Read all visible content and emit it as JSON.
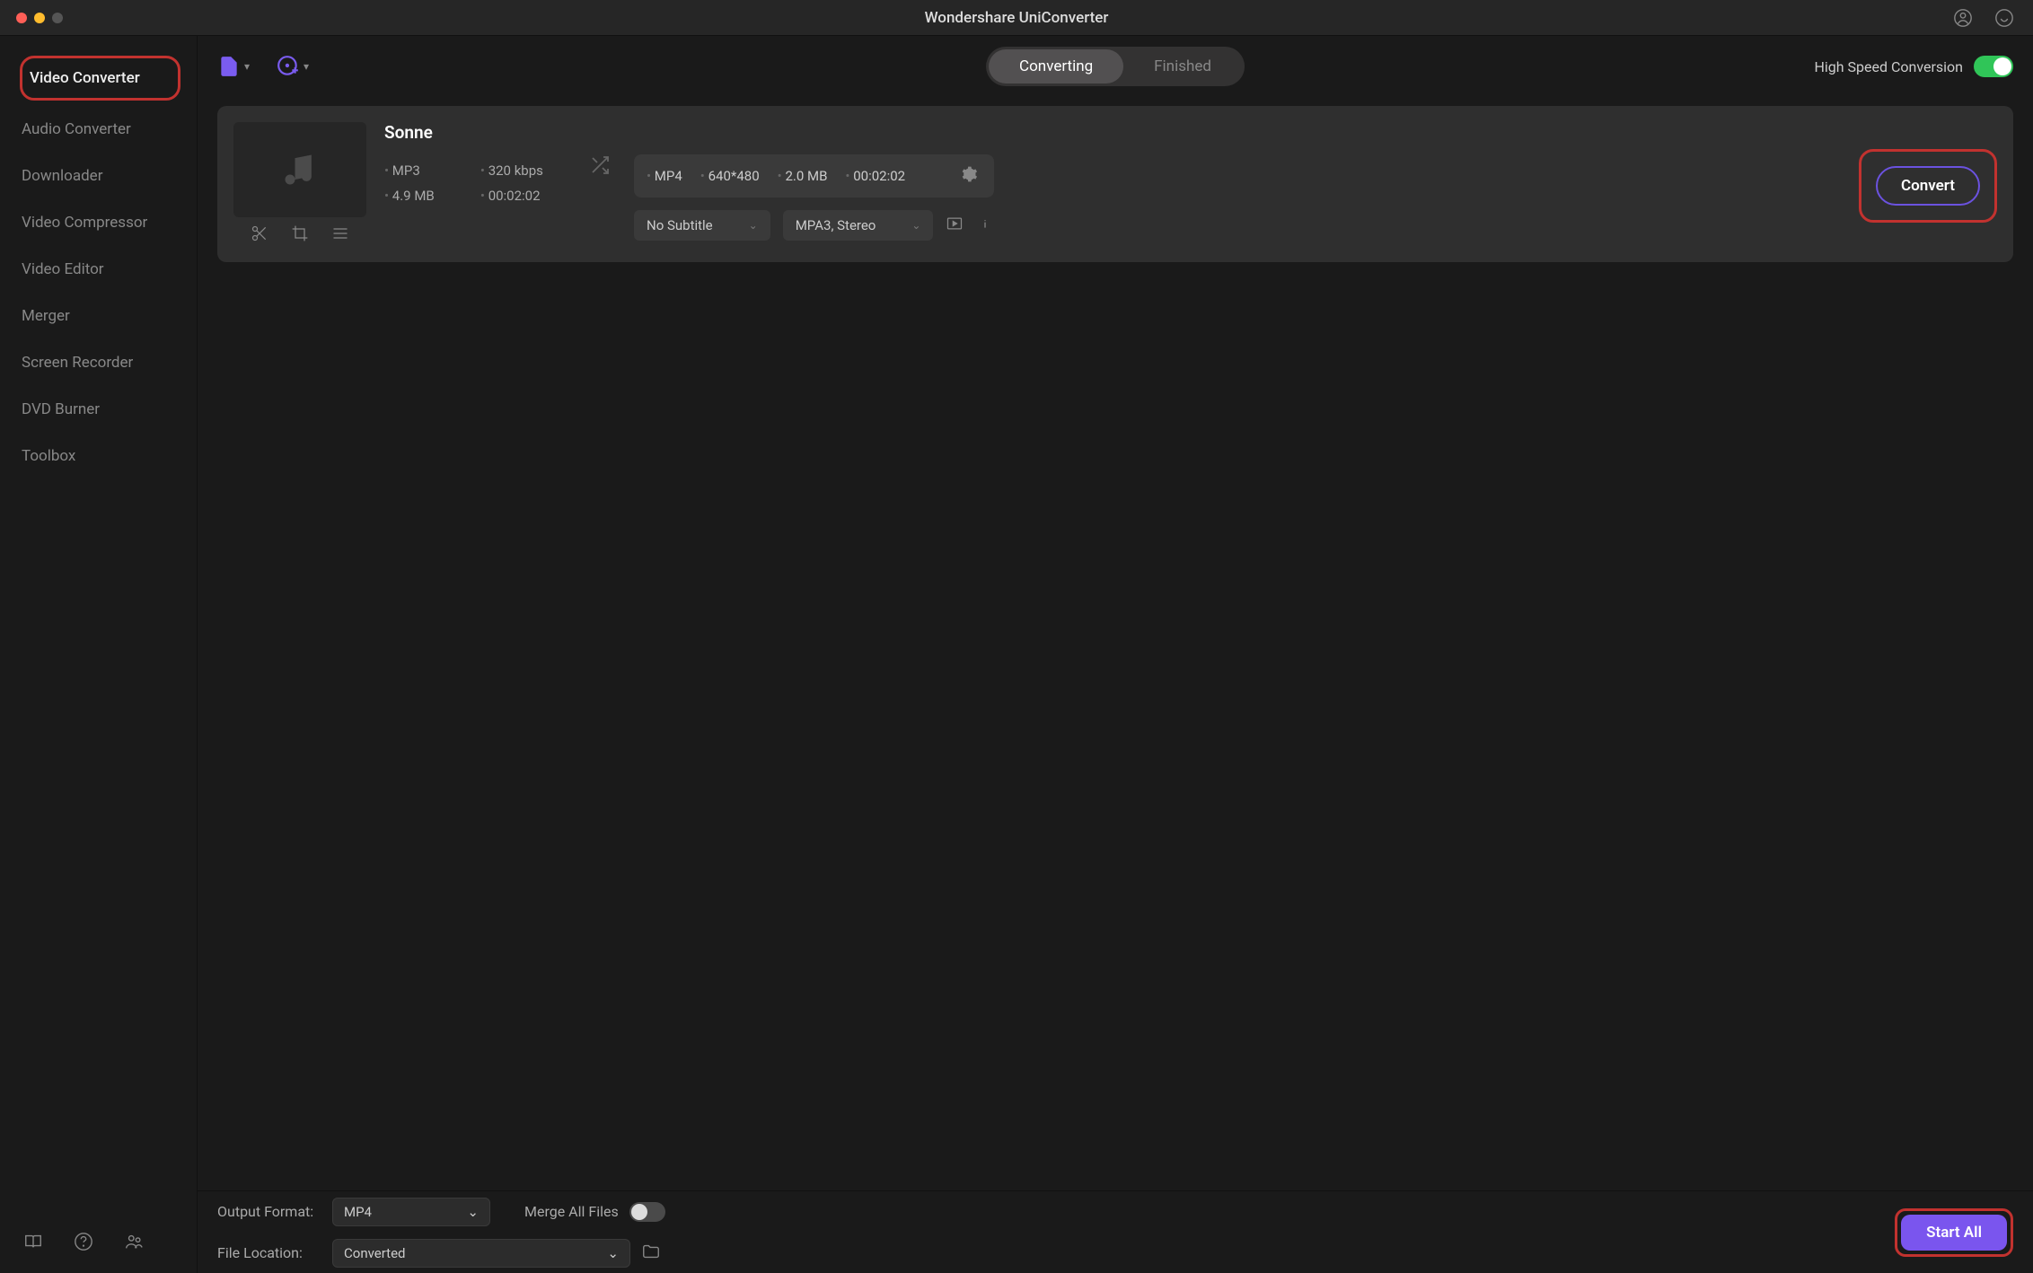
{
  "app": {
    "title": "Wondershare UniConverter"
  },
  "sidebar": {
    "items": [
      "Video Converter",
      "Audio Converter",
      "Downloader",
      "Video Compressor",
      "Video Editor",
      "Merger",
      "Screen Recorder",
      "DVD Burner",
      "Toolbox"
    ]
  },
  "tabs": {
    "converting": "Converting",
    "finished": "Finished"
  },
  "toolbar": {
    "highspeed_label": "High Speed Conversion"
  },
  "file": {
    "name": "Sonne",
    "in_format": "MP3",
    "in_bitrate": "320 kbps",
    "in_size": "4.9 MB",
    "in_duration": "00:02:02",
    "out_format": "MP4",
    "out_res": "640*480",
    "out_size": "2.0 MB",
    "out_duration": "00:02:02",
    "subtitle_sel": "No Subtitle",
    "audio_sel": "MPA3, Stereo",
    "convert_label": "Convert"
  },
  "footer": {
    "output_label": "Output Format:",
    "output_value": "MP4",
    "location_label": "File Location:",
    "location_value": "Converted",
    "merge_label": "Merge All Files",
    "start_label": "Start All"
  }
}
